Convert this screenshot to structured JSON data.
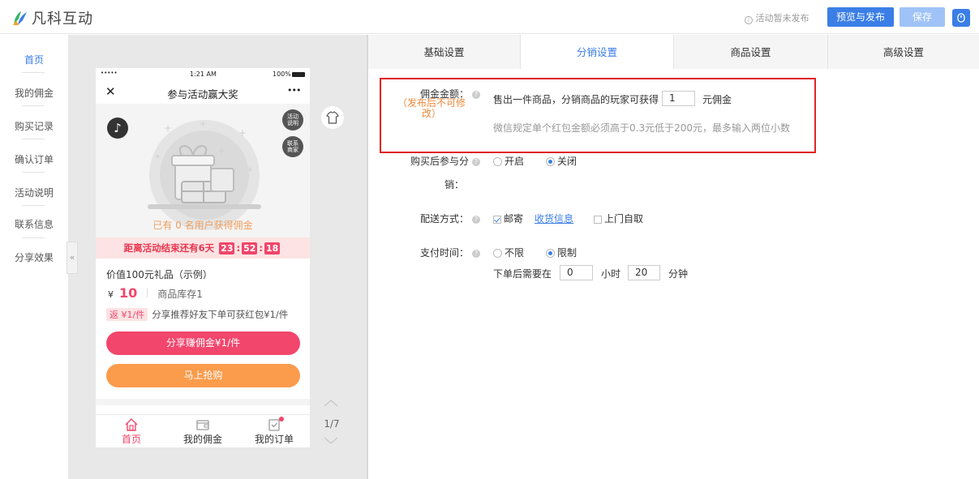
{
  "header": {
    "brand": "凡科互动",
    "status": "活动暂未发布",
    "preview_publish": "预览与发布",
    "save": "保存"
  },
  "sidebar": {
    "items": [
      {
        "label": "首页",
        "active": true
      },
      {
        "label": "我的佣金"
      },
      {
        "label": "购买记录"
      },
      {
        "label": "确认订单"
      },
      {
        "label": "活动说明"
      },
      {
        "label": "联系信息"
      },
      {
        "label": "分享效果"
      }
    ],
    "collapse_glyph": "«"
  },
  "phone": {
    "status_bar": {
      "signal": "•••••",
      "time": "1:21 AM",
      "battery": "100%"
    },
    "nav_title": "参与活动赢大奖",
    "close_glyph": "✕",
    "more_glyph": "•••",
    "side_tags": [
      "活动说明",
      "联系商家"
    ],
    "users_text": "已有 0 名用户获得佣金",
    "countdown": {
      "label": "距离活动结束还有6天",
      "h": "23",
      "m": "52",
      "s": "18"
    },
    "product_title": "价值100元礼品（示例）",
    "currency": "¥",
    "price": "10",
    "stock": "商品库存1",
    "rebate_tag": "返 ¥1/件",
    "rebate_text": "分享推荐好友下单可获红包¥1/件",
    "share_button": "分享赚佣金¥1/件",
    "buy_button": "马上抢购",
    "tabs": [
      {
        "label": "首页",
        "active": true
      },
      {
        "label": "我的佣金"
      },
      {
        "label": "我的订单"
      }
    ],
    "page_indicator": "1/7"
  },
  "settings": {
    "tabs": [
      "基础设置",
      "分销设置",
      "商品设置",
      "高级设置"
    ],
    "active_tab": "分销设置",
    "commission": {
      "label": "佣金金额：",
      "note": "（发布后不可修改）",
      "text_before": "售出一件商品，分销商品的玩家可获得",
      "value": "1",
      "text_after": "元佣金",
      "hint": "微信规定单个红包金额必须高于0.3元低于200元，最多输入两位小数"
    },
    "after_purchase": {
      "label_line1": "购买后参与分",
      "label_line2": "销：",
      "option_on": "开启",
      "option_off": "关闭",
      "selected": "关闭"
    },
    "delivery": {
      "label": "配送方式：",
      "option_mail": "邮寄",
      "link": "收货信息",
      "option_pickup": "上门自取",
      "mail_checked": true,
      "pickup_checked": false
    },
    "pay_time": {
      "label": "支付时间：",
      "option_unlimited": "不限",
      "option_limited": "限制",
      "selected": "限制",
      "prefix": "下单后需要在",
      "hours": "0",
      "hours_unit": "小时",
      "minutes": "20",
      "minutes_unit": "分钟"
    }
  },
  "colors": {
    "accent": "#3a7ee6",
    "pink": "#f2466c",
    "orange": "#fb9b4c",
    "highlight_red": "#e02424",
    "note_orange": "#f0883a"
  }
}
